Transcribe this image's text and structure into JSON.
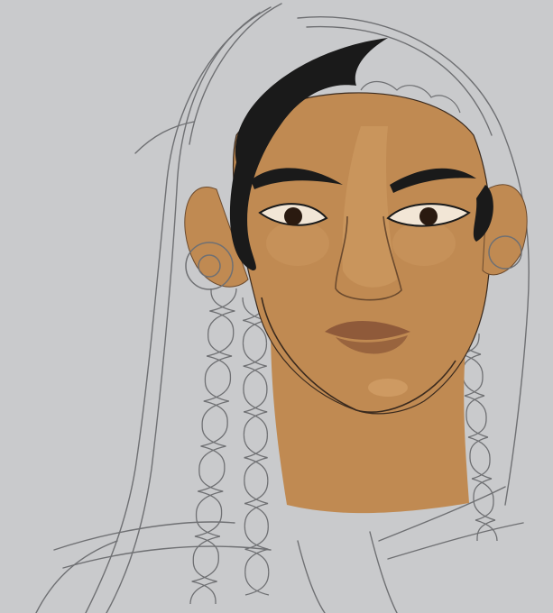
{
  "artwork": {
    "subject": "portrait-illustration",
    "palette": {
      "background": "#c9cacc",
      "skin": "#c08a52",
      "skin_shadow": "#a8733f",
      "skin_highlight": "#d9a870",
      "hair": "#1a1a1a",
      "lips": "#8f5a3a",
      "sketch_line": "#6f7073"
    }
  }
}
